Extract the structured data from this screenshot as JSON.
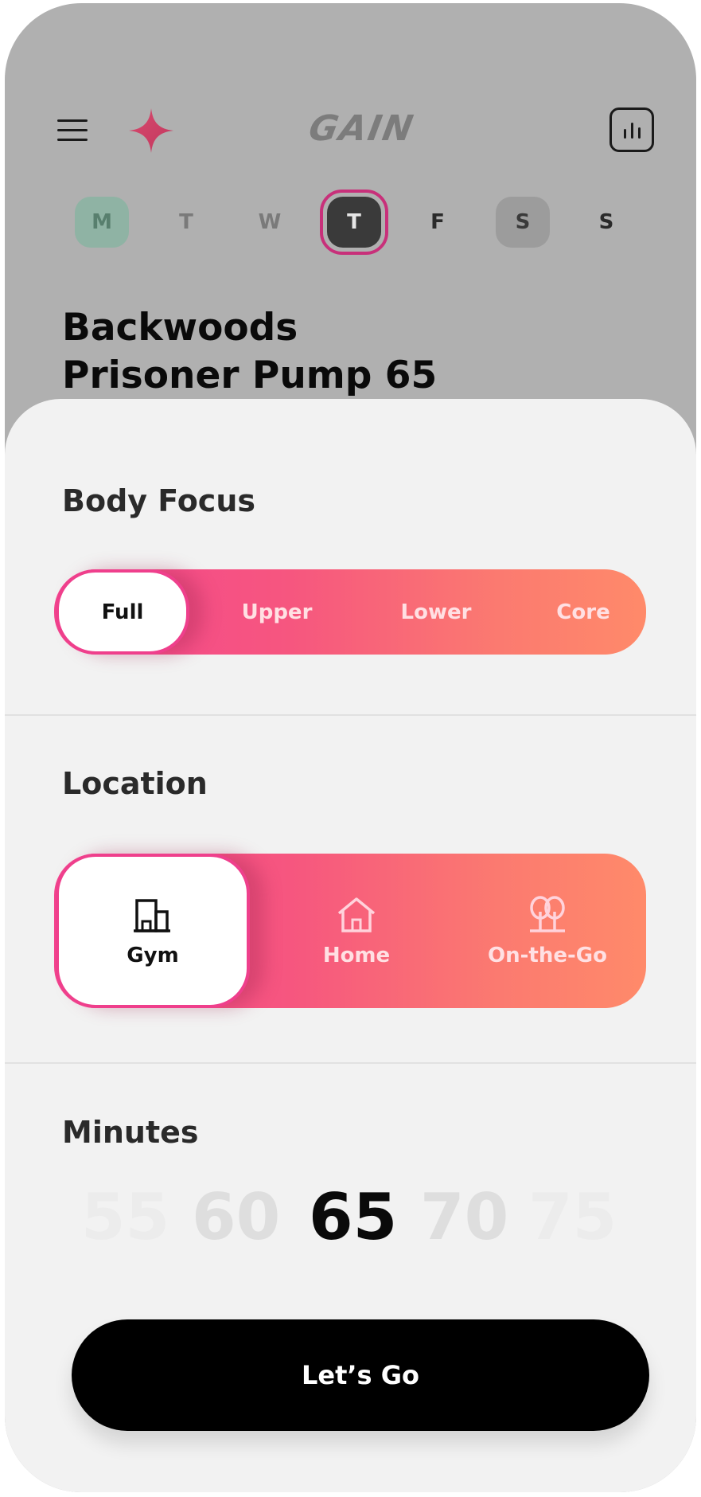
{
  "header": {
    "logo_text": "GAIN",
    "menu_icon": "hamburger-menu-icon",
    "ai_icon": "sparkle-icon",
    "stats_icon": "bar-chart-icon",
    "accent": "#e8486f"
  },
  "week": [
    {
      "label": "M",
      "state": "done"
    },
    {
      "label": "T",
      "state": "idle"
    },
    {
      "label": "W",
      "state": "idle"
    },
    {
      "label": "T",
      "state": "today"
    },
    {
      "label": "F",
      "state": "idle"
    },
    {
      "label": "S",
      "state": "weekend"
    },
    {
      "label": "S",
      "state": "idle"
    }
  ],
  "workout": {
    "title_line1": "Backwoods",
    "title_line2": "Prisoner Pump 65"
  },
  "body_focus": {
    "title": "Body Focus",
    "options": [
      "Full",
      "Upper",
      "Lower",
      "Core"
    ],
    "selected": "Full"
  },
  "location": {
    "title": "Location",
    "options": [
      {
        "label": "Gym",
        "icon": "gym-building-icon"
      },
      {
        "label": "Home",
        "icon": "house-icon"
      },
      {
        "label": "On-the-Go",
        "icon": "trees-icon"
      }
    ],
    "selected": "Gym"
  },
  "minutes": {
    "title": "Minutes",
    "values": [
      "55",
      "60",
      "65",
      "70",
      "75"
    ],
    "selected": "65"
  },
  "cta": {
    "label": "Let’s Go"
  },
  "colors": {
    "gradient_start": "#f4468f",
    "gradient_end": "#ff8a6a",
    "today_ring": "#c8307a",
    "completed_day": "#8fb3a4"
  }
}
